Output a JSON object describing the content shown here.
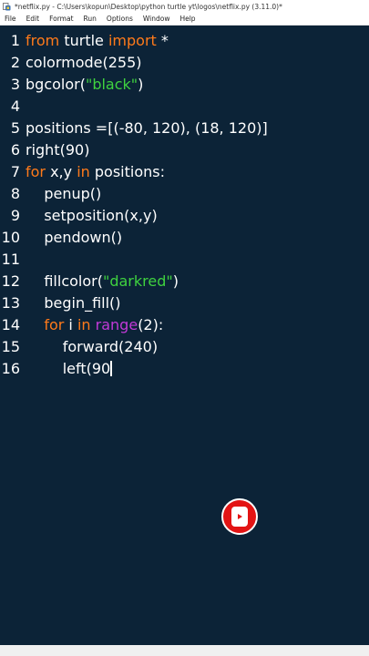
{
  "window": {
    "title": "*netflix.py - C:\\Users\\kopun\\Desktop\\python turtle yt\\logos\\netflix.py (3.11.0)*"
  },
  "menu": [
    "File",
    "Edit",
    "Format",
    "Run",
    "Options",
    "Window",
    "Help"
  ],
  "line_numbers": [
    "1",
    "2",
    "3",
    "4",
    "5",
    "6",
    "7",
    "8",
    "9",
    "10",
    "11",
    "12",
    "13",
    "14",
    "15",
    "16"
  ],
  "code": {
    "l1": {
      "kw1": "from",
      "t1": " turtle ",
      "kw2": "import",
      "t2": " *"
    },
    "l2": {
      "t1": "colormode(255)"
    },
    "l3": {
      "t1": "bgcolor(",
      "s1": "\"black\"",
      "t2": ")"
    },
    "l5": {
      "t1": "positions =[(-80, 120), (18, 120)]"
    },
    "l6": {
      "t1": "right(90)"
    },
    "l7": {
      "kw1": "for",
      "t1": " x,y ",
      "kw2": "in",
      "t2": " positions:"
    },
    "l8": {
      "t1": "    penup()"
    },
    "l9": {
      "t1": "    setposition(x,y)"
    },
    "l10": {
      "t1": "    pendown()"
    },
    "l12": {
      "t1": "    fillcolor(",
      "s1": "\"darkred\"",
      "t2": ")"
    },
    "l13": {
      "t1": "    begin_fill()"
    },
    "l14": {
      "t0": "    ",
      "kw1": "for",
      "t1": " i ",
      "kw2": "in",
      "t2": " ",
      "b1": "range",
      "t3": "(2):"
    },
    "l15": {
      "t1": "        forward(240)"
    },
    "l16": {
      "t1": "        left(90"
    }
  },
  "colors": {
    "background": "#0c2337",
    "keyword": "#ff7a1a",
    "string": "#3fd23f",
    "builtin": "#c23ad8",
    "text": "#ffffff",
    "shorts_red": "#e31414"
  },
  "icons": {
    "app": "python-idle-icon",
    "shorts": "youtube-shorts-icon"
  }
}
